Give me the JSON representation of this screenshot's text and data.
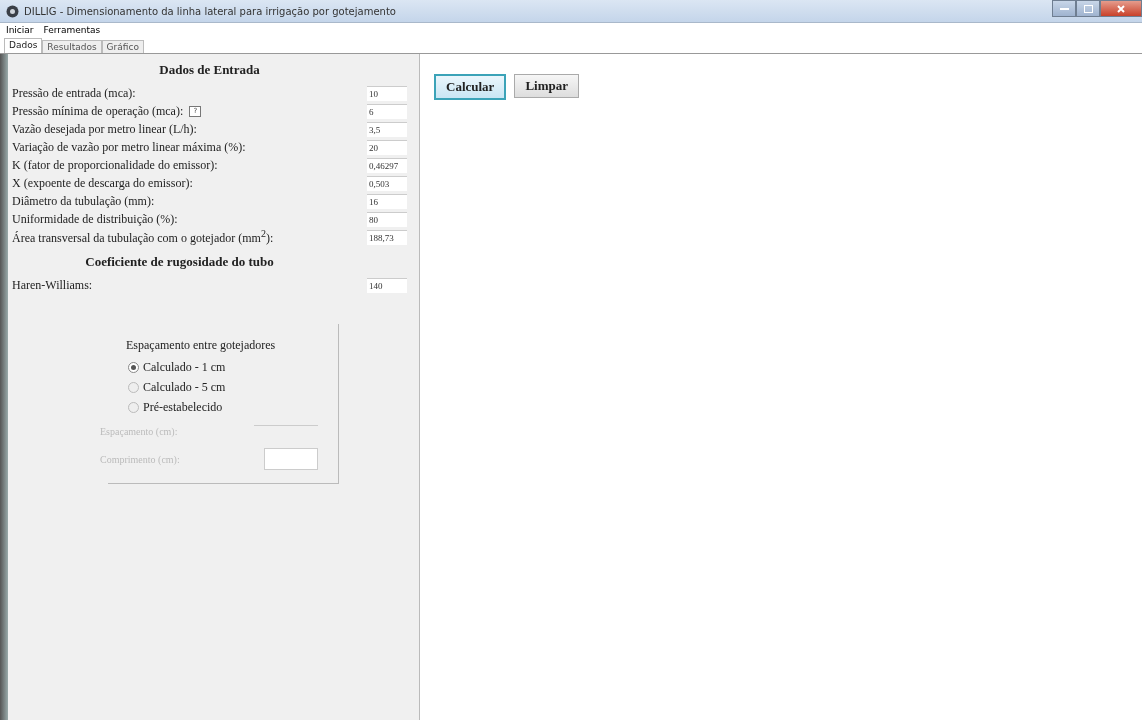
{
  "window": {
    "title": "DILLIG - Dimensionamento da linha lateral para irrigação por gotejamento"
  },
  "menu": [
    "Iniciar",
    "Ferramentas"
  ],
  "tabs": [
    {
      "label": "Dados",
      "selected": true
    },
    {
      "label": "Resultados",
      "selected": false
    },
    {
      "label": "Gráfico",
      "selected": false
    }
  ],
  "input_section": {
    "title": "Dados de Entrada",
    "fields": [
      {
        "label": "Pressão de entrada (mca):",
        "value": "10"
      },
      {
        "label": "Pressão mínima de operação (mca):",
        "value": "6",
        "help": "?"
      },
      {
        "label": "Vazão desejada por metro linear (L/h):",
        "value": "3,5"
      },
      {
        "label": "Variação de vazão por metro linear máxima (%):",
        "value": "20"
      },
      {
        "label": "K (fator de proporcionalidade do emissor):",
        "value": "0,46297"
      },
      {
        "label": "X (expoente de descarga do emissor):",
        "value": "0,503"
      },
      {
        "label": "Diâmetro da tubulação (mm):",
        "value": "16"
      },
      {
        "label": "Uniformidade de distribuição (%):",
        "value": "80"
      },
      {
        "label": "Área transversal da tubulação com o gotejador  (mm$^{2}$):",
        "value": "188,73"
      }
    ]
  },
  "roughness_section": {
    "title": "Coeficiente de rugosidade do tubo",
    "fields": [
      {
        "label": "Haren-Williams:",
        "value": "140"
      }
    ]
  },
  "spacing_group": {
    "title": "Espaçamento entre gotejadores",
    "options": [
      {
        "label": "Calculado - 1 cm",
        "selected": true
      },
      {
        "label": "Calculado - 5 cm",
        "selected": false
      },
      {
        "label": "Pré-estabelecido",
        "selected": false
      }
    ],
    "fields": [
      {
        "label": "Espaçamento (cm):",
        "kind": "flat",
        "disabled": true
      },
      {
        "label": "Comprimento (cm):",
        "kind": "box",
        "disabled": true
      }
    ]
  },
  "buttons": [
    {
      "label": "Calcular",
      "focused": true
    },
    {
      "label": "Limpar",
      "focused": false
    }
  ]
}
